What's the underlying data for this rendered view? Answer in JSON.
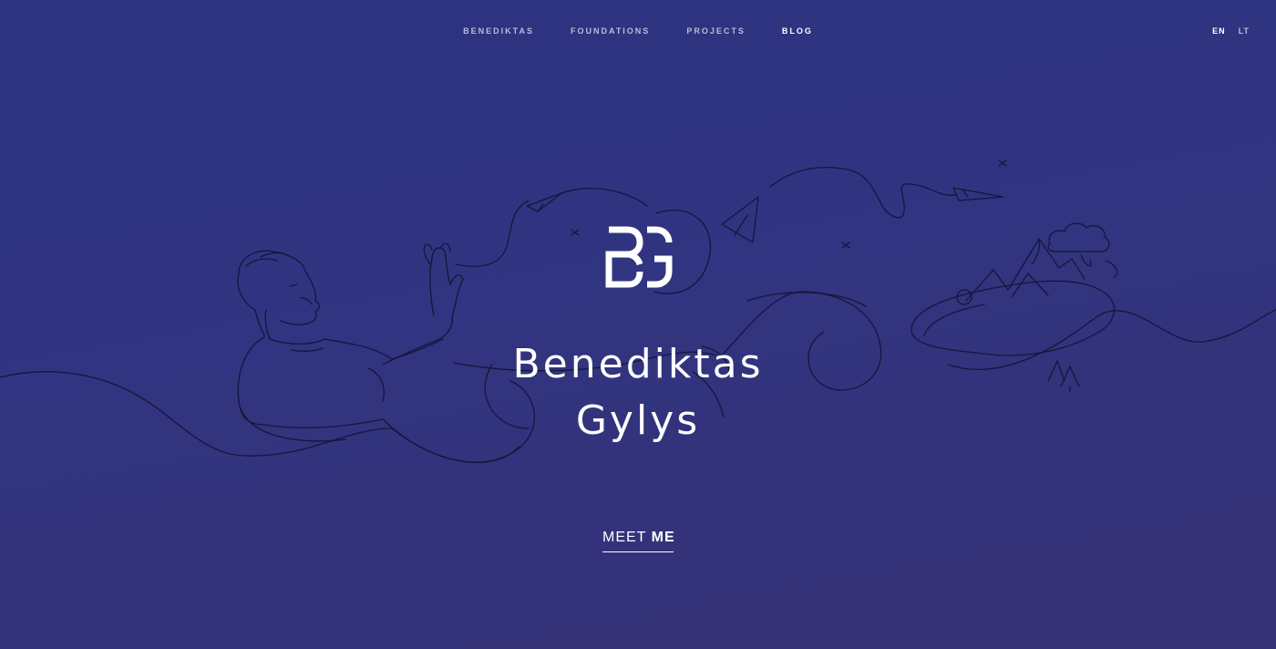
{
  "nav": {
    "items": [
      {
        "label": "BENEDIKTAS",
        "active": false
      },
      {
        "label": "FOUNDATIONS",
        "active": false
      },
      {
        "label": "PROJECTS",
        "active": false
      },
      {
        "label": "BLOG",
        "active": true
      }
    ]
  },
  "languages": {
    "en": "EN",
    "lt": "LT",
    "selected": "EN"
  },
  "logo": {
    "mark": "BG"
  },
  "hero": {
    "first_name": "Benediktas",
    "last_name": "Gylys"
  },
  "cta": {
    "word1": "MEET",
    "word2": "ME"
  },
  "colors": {
    "background": "#2f3380",
    "text": "#ffffff",
    "nav_inactive": "#b8bcdc",
    "line_art": "#14163a"
  },
  "icons": [
    "bg-monogram-logo",
    "paper-plane-icon",
    "line-illustration"
  ]
}
